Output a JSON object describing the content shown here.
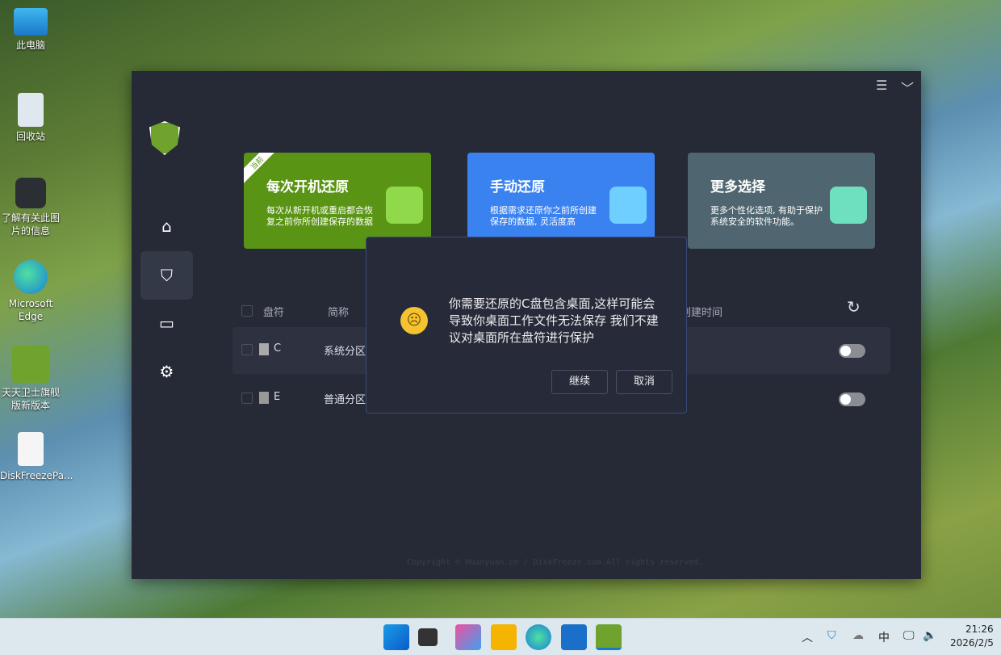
{
  "desktop": {
    "icons": [
      "此电脑",
      "回收站",
      "了解有关此图片的信息",
      "Microsoft Edge",
      "天天卫士旗舰版新版本",
      "DiskFreezePa..."
    ]
  },
  "app": {
    "sidebar": [
      "home-icon",
      "shield-icon",
      "monitor-icon",
      "gear-icon"
    ],
    "cards": [
      {
        "badge": "当前",
        "title": "每次开机还原",
        "desc": "每次从新开机或重启都会恢复之前你所创建保存的数据",
        "color": "#5a9414"
      },
      {
        "title": "手动还原",
        "desc": "根据需求还原你之前所创建保存的数据, 灵活度高",
        "color": "#3a82f0"
      },
      {
        "title": "更多选择",
        "desc": "更多个性化选项, 有助于保护系统安全的软件功能。",
        "color": "#4f6670"
      }
    ],
    "table": {
      "headers": [
        "盘符",
        "简称",
        "创建时间"
      ],
      "rows": [
        {
          "drive": "C",
          "name": "系统分区",
          "enabled": false
        },
        {
          "drive": "E",
          "name": "普通分区",
          "enabled": false
        }
      ]
    },
    "copyright": "Copyright ©  Huanyuan.cn / DiskFreeze.com.All rights reserved."
  },
  "dialog": {
    "message": "你需要还原的C盘包含桌面,这样可能会导致你桌面工作文件无法保存 我们不建议对桌面所在盘符进行保护",
    "continue": "继续",
    "cancel": "取消"
  },
  "taskbar": {
    "ime": "中",
    "time": "21:26",
    "date": "2026/2/5"
  }
}
